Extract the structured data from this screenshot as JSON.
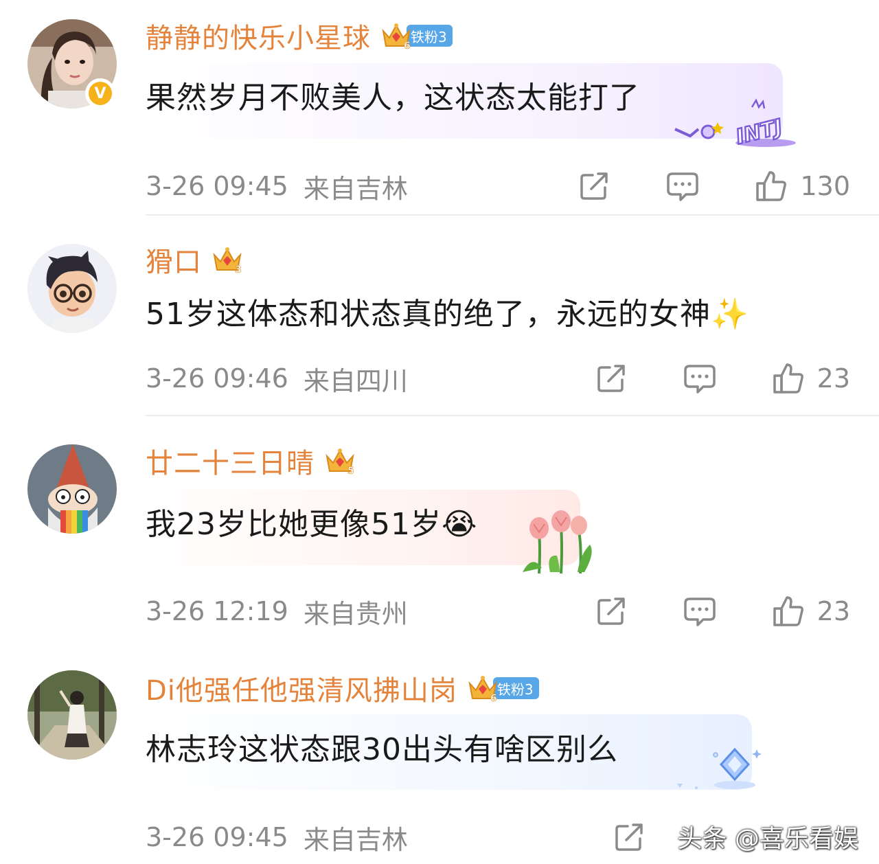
{
  "comments": [
    {
      "username": "静静的快乐小星球",
      "fan_badge": "铁粉3",
      "crown_level": "6",
      "verified": "V",
      "text": "果然岁月不败美人，这状态太能打了",
      "sticker_text": "INTJ",
      "timestamp": "3-26 09:45",
      "location": "来自吉林",
      "likes": "130"
    },
    {
      "username": "猾口",
      "crown_level": "3",
      "text": "51岁这体态和状态真的绝了，永远的女神✨",
      "timestamp": "3-26 09:46",
      "location": "来自四川",
      "likes": "23"
    },
    {
      "username": "廿二十三日晴",
      "crown_level": "5",
      "text": "我23岁比她更像51岁😭",
      "timestamp": "3-26 12:19",
      "location": "来自贵州",
      "likes": "23"
    },
    {
      "username": "Di他强任他强清风拂山岗",
      "fan_badge": "铁粉3",
      "crown_level": "6",
      "text": "林志玲这状态跟30出头有啥区别么",
      "timestamp": "3-26 09:45",
      "location": "来自吉林"
    }
  ],
  "watermark": "头条 @喜乐看娱",
  "icons": [
    "share-icon",
    "comment-icon",
    "like-icon",
    "crown-icon",
    "verified-icon"
  ],
  "colors": {
    "username": "#e4843c",
    "meta_text": "#8a8a8a",
    "fan_badge": "#56a6e8",
    "verified": "#f6b21a"
  }
}
